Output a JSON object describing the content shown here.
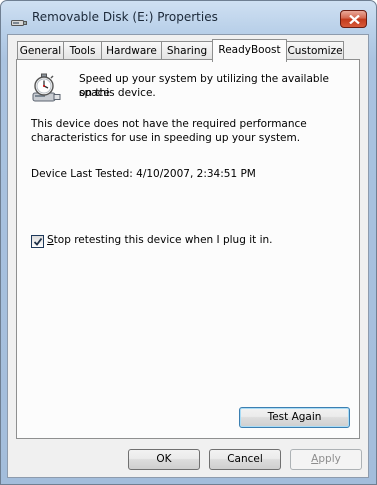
{
  "window": {
    "title": "Removable Disk (E:) Properties"
  },
  "tabs": [
    {
      "label": "General"
    },
    {
      "label": "Tools"
    },
    {
      "label": "Hardware"
    },
    {
      "label": "Sharing"
    },
    {
      "label": "ReadyBoost"
    },
    {
      "label": "Customize"
    }
  ],
  "active_tab": "ReadyBoost",
  "readyboost": {
    "intro_line1": "Speed up your system by utilizing the available space",
    "intro_line2": "on this device.",
    "message_line1": "This device does not have the required performance",
    "message_line2": "characteristics for use in speeding up your system.",
    "last_tested": "Device Last Tested: 4/10/2007, 2:34:51 PM",
    "stop_retesting": {
      "accel": "S",
      "rest": "top retesting this device when I plug it in.",
      "checked": true
    },
    "test_again_label": "Test Again"
  },
  "buttons": {
    "ok": "OK",
    "cancel": "Cancel",
    "apply_accel": "A",
    "apply_rest": "pply"
  },
  "colors": {
    "titlebar": "#b9d0e9",
    "close_button": "#c23a1c",
    "dialog_bg": "#f0f0f0",
    "default_button_border": "#3c7fb1",
    "disabled_text": "#8d8d8d"
  },
  "icons": [
    "usb-drive-icon",
    "close-icon",
    "readyboost-stopwatch-icon",
    "checkmark-icon"
  ]
}
